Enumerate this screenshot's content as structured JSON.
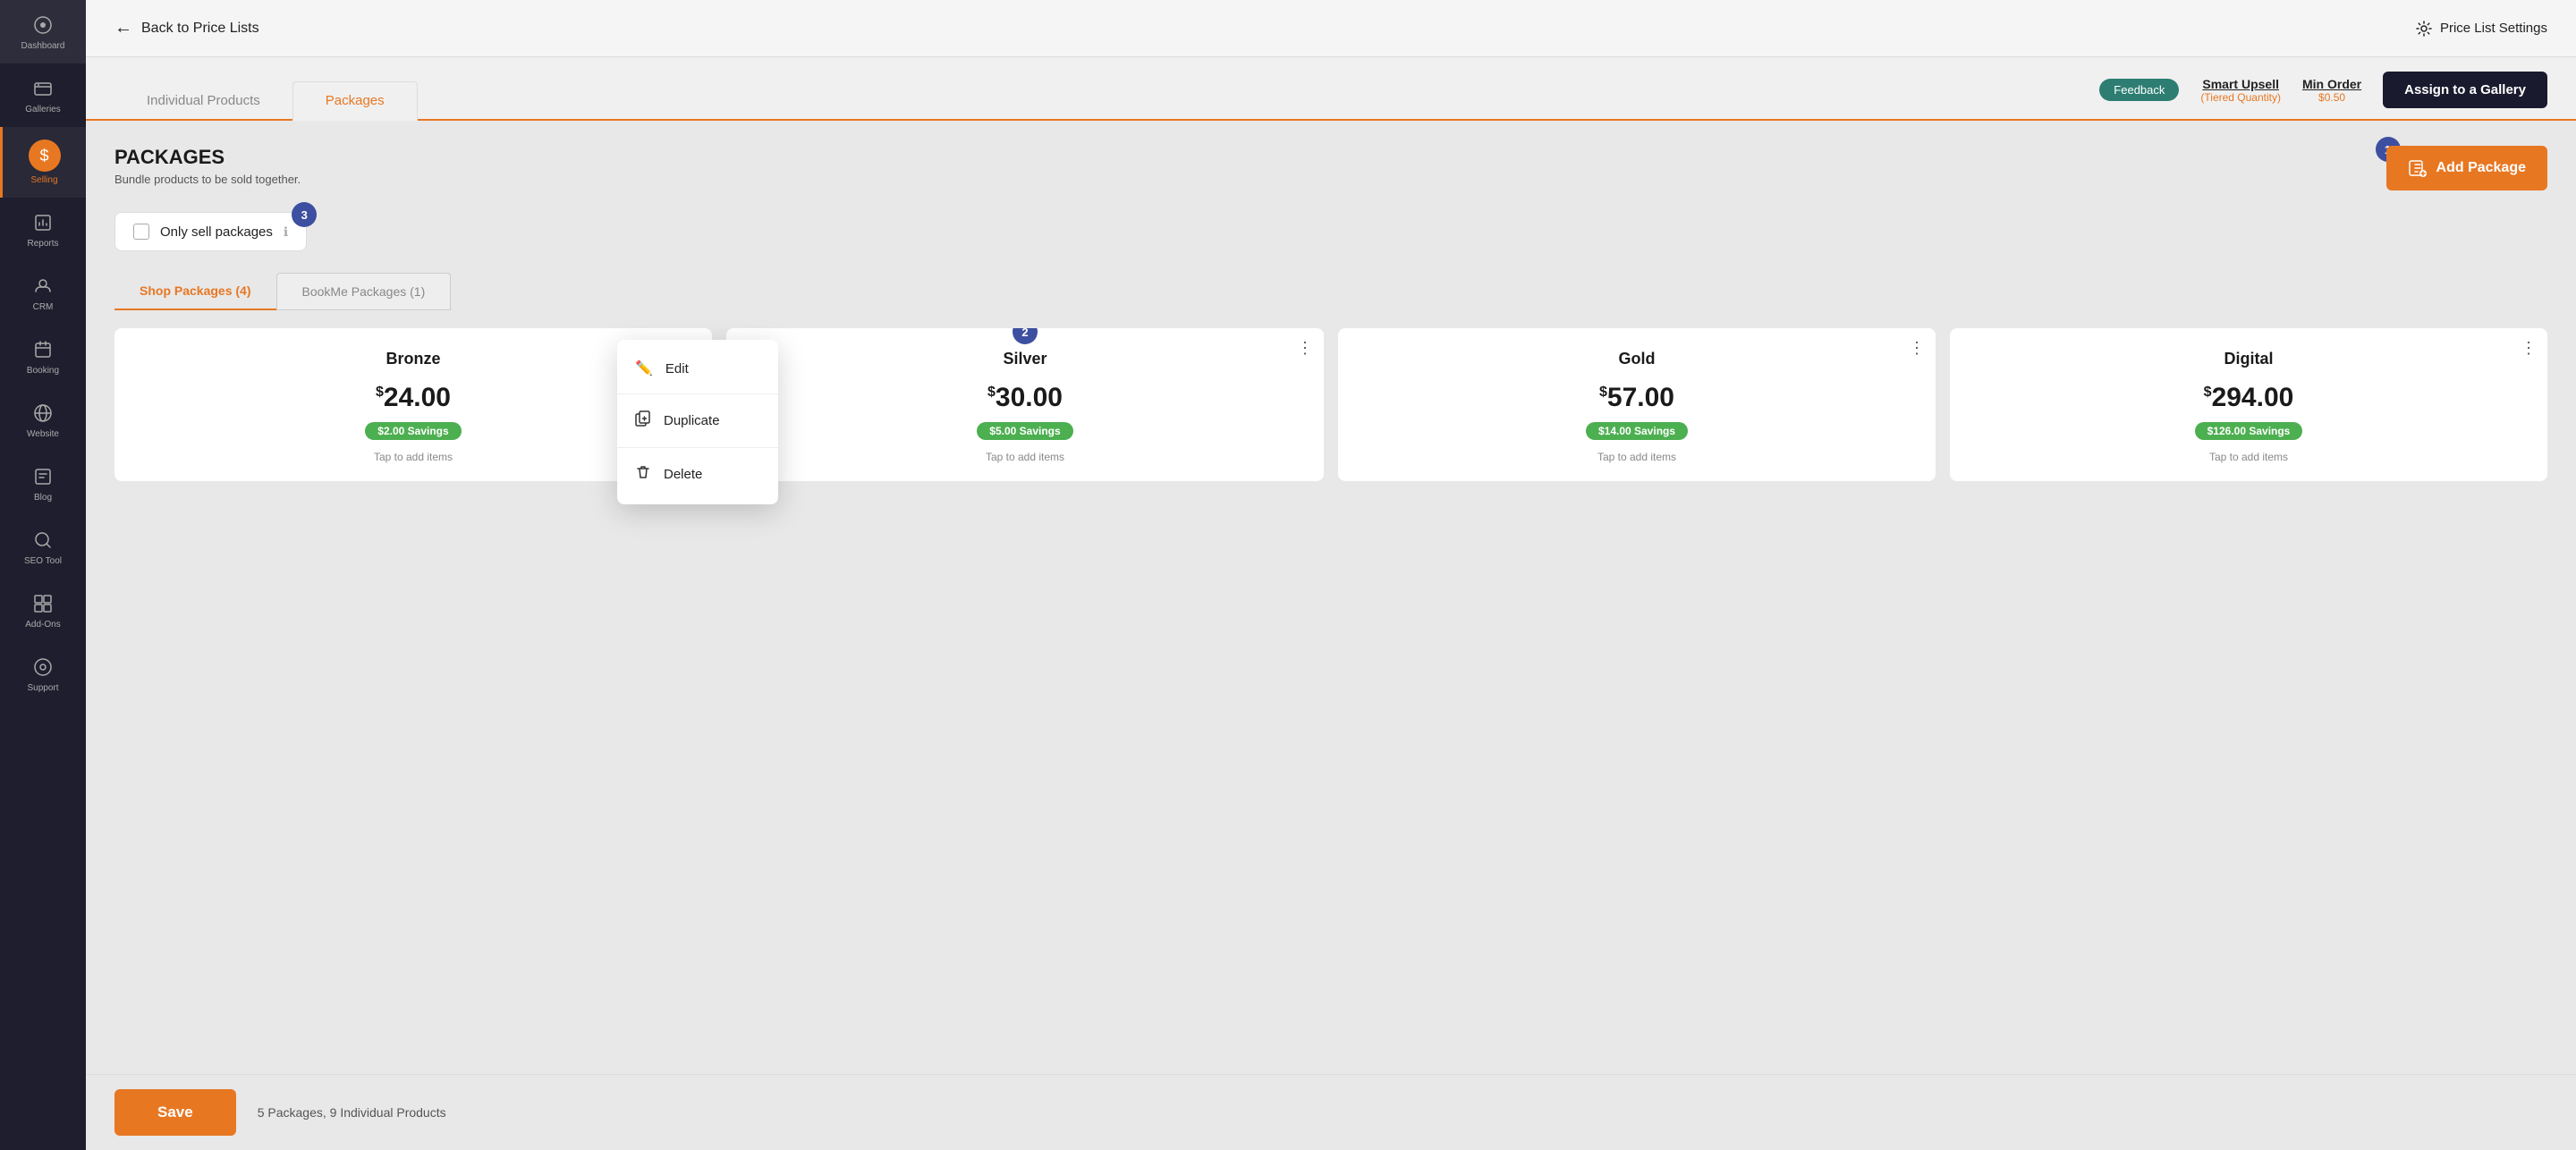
{
  "sidebar": {
    "items": [
      {
        "id": "dashboard",
        "label": "Dashboard",
        "icon": "⊙"
      },
      {
        "id": "galleries",
        "label": "Galleries",
        "icon": "🖼"
      },
      {
        "id": "selling",
        "label": "Selling",
        "icon": "$",
        "active": true
      },
      {
        "id": "reports",
        "label": "Reports",
        "icon": "📊"
      },
      {
        "id": "crm",
        "label": "CRM",
        "icon": "✉"
      },
      {
        "id": "booking",
        "label": "Booking",
        "icon": "📅"
      },
      {
        "id": "website",
        "label": "Website",
        "icon": "🌐"
      },
      {
        "id": "blog",
        "label": "Blog",
        "icon": "📝"
      },
      {
        "id": "seo_tool",
        "label": "SEO Tool",
        "icon": "🔍"
      },
      {
        "id": "add_ons",
        "label": "Add-Ons",
        "icon": "⊞"
      },
      {
        "id": "support",
        "label": "Support",
        "icon": "?"
      }
    ]
  },
  "topbar": {
    "back_label": "Back to Price Lists",
    "settings_label": "Price List Settings"
  },
  "tabs": {
    "left": [
      {
        "id": "individual",
        "label": "Individual Products",
        "active": false
      },
      {
        "id": "packages",
        "label": "Packages",
        "active": true
      }
    ],
    "feedback_label": "Feedback",
    "smart_upsell_title": "Smart Upsell",
    "smart_upsell_sub": "(Tiered Quantity)",
    "min_order_title": "Min Order",
    "min_order_val": "$0.50",
    "assign_gallery_label": "Assign to a Gallery"
  },
  "packages": {
    "title": "PACKAGES",
    "subtitle": "Bundle products to be sold together.",
    "add_label": "Add Package",
    "badge_1": "1",
    "only_sell_label": "Only sell packages",
    "badge_3": "3",
    "sub_tabs": [
      {
        "id": "shop",
        "label": "Shop Packages (4)",
        "active": true
      },
      {
        "id": "bookme",
        "label": "BookMe Packages (1)",
        "active": false
      }
    ],
    "cards": [
      {
        "name": "Bronze",
        "price": "24.00",
        "savings": "$2.00 Savings",
        "included": "Tap to add items"
      },
      {
        "name": "Silver",
        "price": "30.00",
        "savings": "$5.00 Savings",
        "included": "Tap to add items",
        "badge": "2"
      },
      {
        "name": "Gold",
        "price": "57.00",
        "savings": "$14.00 Savings",
        "included": "Tap to add items"
      },
      {
        "name": "Digital",
        "price": "294.00",
        "savings": "$126.00 Savings",
        "included": "Tap to add items"
      }
    ]
  },
  "context_menu": {
    "items": [
      {
        "id": "edit",
        "label": "Edit",
        "icon": "✏️"
      },
      {
        "id": "duplicate",
        "label": "Duplicate",
        "icon": "⧉"
      },
      {
        "id": "delete",
        "label": "Delete",
        "icon": "🗑"
      }
    ]
  },
  "bottom_bar": {
    "save_label": "Save",
    "info_text": "5 Packages, 9 Individual Products"
  }
}
